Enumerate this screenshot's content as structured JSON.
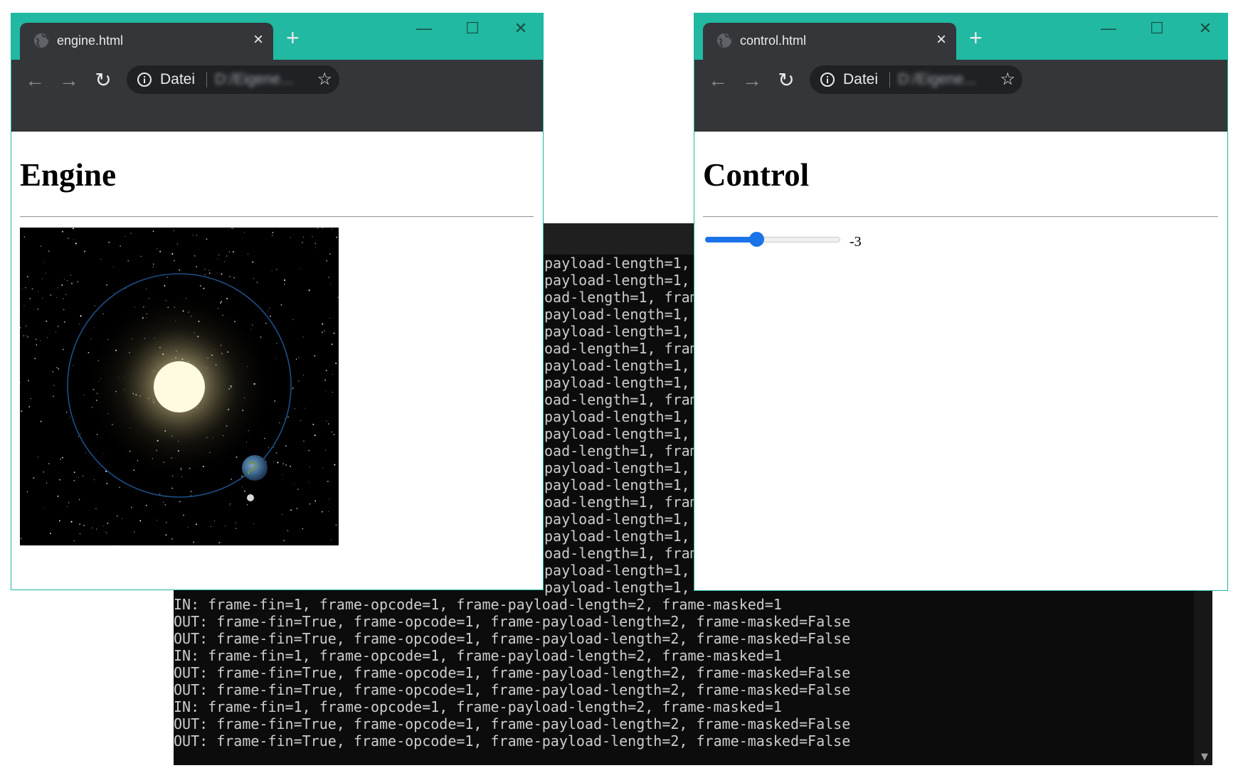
{
  "terminal": {
    "lines_right_clipped": [
      "payload-length=1,",
      "payload-length=1,",
      "oad-length=1, fram",
      "payload-length=1,",
      "payload-length=1,",
      "oad-length=1, fram",
      "payload-length=1,",
      "payload-length=1,",
      "oad-length=1, fram",
      "payload-length=1,",
      "payload-length=1,",
      "oad-length=1, fram",
      "payload-length=1,",
      "payload-length=1,",
      "oad-length=1, fram",
      "payload-length=1,",
      "payload-length=1,",
      "oad-length=1, fram",
      "payload-length=1,",
      "payload-length=1,"
    ],
    "lines_full": [
      "IN: frame-fin=1, frame-opcode=1, frame-payload-length=2, frame-masked=1",
      "OUT: frame-fin=True, frame-opcode=1, frame-payload-length=2, frame-masked=False",
      "OUT: frame-fin=True, frame-opcode=1, frame-payload-length=2, frame-masked=False",
      "IN: frame-fin=1, frame-opcode=1, frame-payload-length=2, frame-masked=1",
      "OUT: frame-fin=True, frame-opcode=1, frame-payload-length=2, frame-masked=False",
      "OUT: frame-fin=True, frame-opcode=1, frame-payload-length=2, frame-masked=False",
      "IN: frame-fin=1, frame-opcode=1, frame-payload-length=2, frame-masked=1",
      "OUT: frame-fin=True, frame-opcode=1, frame-payload-length=2, frame-masked=False",
      "OUT: frame-fin=True, frame-opcode=1, frame-payload-length=2, frame-masked=False"
    ]
  },
  "engine_window": {
    "tab_title": "engine.html",
    "tab_close": "×",
    "new_tab": "+",
    "window_controls": {
      "minimize": "—",
      "maximize": "☐",
      "close": "✕"
    },
    "nav": {
      "back": "←",
      "forward": "→",
      "reload": "↻"
    },
    "address": {
      "scheme_label": "Datei",
      "url_blurred": "D:/Eigene...",
      "star": "☆"
    },
    "page_heading": "Engine"
  },
  "control_window": {
    "tab_title": "control.html",
    "tab_close": "×",
    "new_tab": "+",
    "window_controls": {
      "minimize": "—",
      "maximize": "☐",
      "close": "✕"
    },
    "nav": {
      "back": "←",
      "forward": "→",
      "reload": "↻"
    },
    "address": {
      "scheme_label": "Datei",
      "url_blurred": "D:/Eigene...",
      "star": "☆"
    },
    "page_heading": "Control",
    "slider": {
      "value_text": "-3",
      "fill_fraction": 0.38
    }
  },
  "colors": {
    "tabstrip_teal": "#21b9a1",
    "chrome_dark": "#35363a",
    "terminal_bg": "#0c0c0c",
    "terminal_text": "#cccccc",
    "slider_blue": "#1a73e8"
  },
  "icons": [
    "globe-icon",
    "info-icon",
    "star-icon",
    "back-arrow-icon",
    "forward-arrow-icon",
    "reload-icon",
    "close-icon",
    "plus-icon",
    "minimize-icon",
    "maximize-icon"
  ]
}
